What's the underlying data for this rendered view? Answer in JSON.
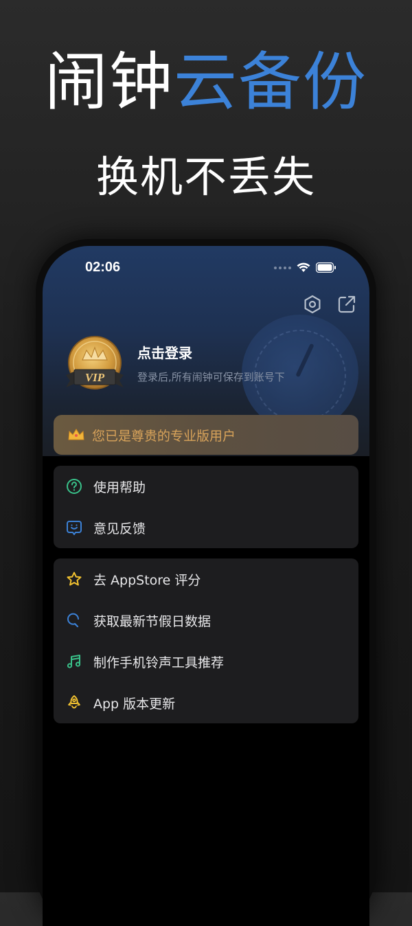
{
  "promo": {
    "headline_part1": "闹钟",
    "headline_part2": "云备份",
    "subheadline": "换机不丢失"
  },
  "status_bar": {
    "time": "02:06"
  },
  "profile": {
    "badge_text": "VIP",
    "login_title": "点击登录",
    "login_subtitle": "登录后,所有闹钟可保存到账号下"
  },
  "pro_banner": {
    "text": "您已是尊贵的专业版用户"
  },
  "menu_group1": [
    {
      "label": "使用帮助",
      "icon": "help-circle-icon"
    },
    {
      "label": "意见反馈",
      "icon": "feedback-smile-icon"
    }
  ],
  "menu_group2": [
    {
      "label": "去 AppStore 评分",
      "icon": "star-icon"
    },
    {
      "label": "获取最新节假日数据",
      "icon": "refresh-search-icon"
    },
    {
      "label": "制作手机铃声工具推荐",
      "icon": "music-note-icon"
    },
    {
      "label": "App 版本更新",
      "icon": "rocket-icon"
    }
  ],
  "colors": {
    "accent_blue": "#3c82d8",
    "gold": "#d8a35a",
    "help_green": "#39c28a",
    "feedback_blue": "#3c82d8",
    "star_yellow": "#f2c230",
    "holiday_blue": "#3c82d8",
    "music_green": "#39c28a",
    "rocket_yellow": "#f2c230"
  }
}
